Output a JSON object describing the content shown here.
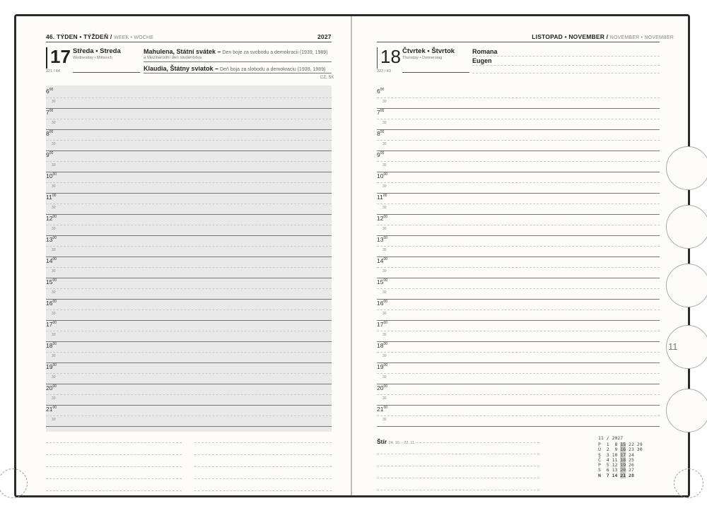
{
  "left": {
    "header": {
      "week_prefix": "46. TÝDEN • TÝŽDEŇ /",
      "week_suffix": "WEEK • WOCHE",
      "year": "2027"
    },
    "day": {
      "num": "17",
      "name": "Středa • Streda",
      "sub": "Wednesday • Mittwoch",
      "daycount": "321 / 44"
    },
    "holidays": [
      {
        "title": "Mahulena, Státní svátek –",
        "desc": " Den boje za svobodu a demokracii (1939, 1989)",
        "sub": "a Mezinárodní den studentstva"
      },
      {
        "title": "Klaudia, Štátny sviatok –",
        "desc": " Deň boja za slobodu a demokraciu (1939, 1989)",
        "sub": "CZ, SK"
      }
    ]
  },
  "right": {
    "header": {
      "month_bold": "LISTOPAD • NOVEMBER /",
      "month_thin": "NOVEMBER • NOVEMBER"
    },
    "day": {
      "num": "18",
      "name": "Čtvrtek • Štvrtok",
      "sub": "Thursday • Donnerstag",
      "daycount": "322 / 43"
    },
    "names": [
      "Romana",
      "Eugen"
    ],
    "zodiac": {
      "sign": "Štír",
      "range": "24. 10. - 22. 11."
    },
    "calendar": {
      "title": "11 / 2027",
      "rows": [
        {
          "d": "P",
          "n": [
            1,
            8,
            15,
            22,
            29
          ]
        },
        {
          "d": "Ú",
          "n": [
            2,
            9,
            16,
            23,
            30
          ]
        },
        {
          "d": "S",
          "n": [
            3,
            10,
            17,
            24
          ]
        },
        {
          "d": "Č",
          "n": [
            4,
            11,
            18,
            25
          ]
        },
        {
          "d": "P",
          "n": [
            5,
            12,
            19,
            26
          ]
        },
        {
          "d": "S",
          "n": [
            6,
            13,
            20,
            27
          ]
        },
        {
          "d": "N",
          "n": [
            7,
            14,
            21,
            28
          ]
        }
      ],
      "highlight_col": 2
    },
    "tab_label": "11"
  },
  "hours": [
    "6",
    "7",
    "8",
    "9",
    "10",
    "11",
    "12",
    "13",
    "14",
    "15",
    "16",
    "17",
    "18",
    "19",
    "20",
    "21"
  ],
  "hour_sup": "00",
  "half_label": "30"
}
